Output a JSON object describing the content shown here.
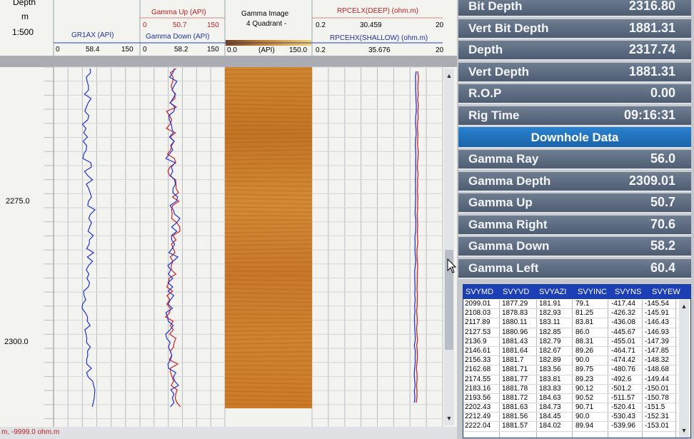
{
  "log_header": {
    "depth_label": "Depth",
    "depth_unit": "m",
    "scale": "1:500",
    "track1": {
      "name": "GR1AX (API)",
      "min": "0",
      "val": "58.4",
      "max": "150"
    },
    "track2": {
      "name1": "Gamma Up (API)",
      "min1": "0",
      "val1": "50.7",
      "max1": "150",
      "name2": "Gamma Down (API)",
      "min2": "0",
      "val2": "58.2",
      "max2": "150"
    },
    "track3": {
      "name": "Gamma Image",
      "sub": "4 Quadrant -",
      "min": "0.0",
      "unit": "(API)",
      "max": "150.0"
    },
    "track4": {
      "name1": "RPCELX(DEEP) (ohm.m)",
      "min1": "0.2",
      "val1": "30.459",
      "max1": "20",
      "name2": "RPCEHX(SHALLOW) (ohm.m)",
      "min2": "0.2",
      "val2": "35.676",
      "max2": "20"
    }
  },
  "depth_marks": [
    "2275.0",
    "2300.0"
  ],
  "status_text": "m, -9999.0 ohm.m",
  "colors": {
    "gr": "#2233cc",
    "gamma_up": "#cc2222",
    "gamma_down": "#2233cc",
    "deep": "#cc2222",
    "shallow": "#2233cc",
    "image": "#c87a22",
    "section": "#1f6fbd"
  },
  "realtime": [
    {
      "label": "Bit Depth",
      "value": "2316.80"
    },
    {
      "label": "Vert Bit Depth",
      "value": "1881.31"
    },
    {
      "label": "Depth",
      "value": "2317.74"
    },
    {
      "label": "Vert Depth",
      "value": "1881.31"
    },
    {
      "label": "R.O.P",
      "value": "0.00"
    },
    {
      "label": "Rig Time",
      "value": "09:16:31"
    }
  ],
  "downhole_title": "Downhole Data",
  "downhole": [
    {
      "label": "Gamma Ray",
      "value": "56.0"
    },
    {
      "label": "Gamma Depth",
      "value": "2309.01"
    },
    {
      "label": "Gamma Up",
      "value": "50.7"
    },
    {
      "label": "Gamma Right",
      "value": "70.6"
    },
    {
      "label": "Gamma Down",
      "value": "58.2"
    },
    {
      "label": "Gamma Left",
      "value": "60.4"
    }
  ],
  "survey": {
    "columns": [
      "SVYMD",
      "SVYVD",
      "SVYAZI",
      "SVYINC",
      "SVYNS",
      "SVYEW"
    ],
    "rows": [
      [
        "2099.01",
        "1877.29",
        "181.91",
        "79.1",
        "-417.44",
        "-145.54"
      ],
      [
        "2108.03",
        "1878.83",
        "182.93",
        "81.25",
        "-426.32",
        "-145.91"
      ],
      [
        "2117.89",
        "1880.11",
        "183.11",
        "83.81",
        "-436.08",
        "-146.43"
      ],
      [
        "2127.53",
        "1880.96",
        "182.85",
        "86.0",
        "-445.67",
        "-146.93"
      ],
      [
        "2136.9",
        "1881.43",
        "182.79",
        "88.31",
        "-455.01",
        "-147.39"
      ],
      [
        "2146.61",
        "1881.64",
        "182.67",
        "89.26",
        "-464.71",
        "-147.85"
      ],
      [
        "2156.33",
        "1881.7",
        "182.89",
        "90.0",
        "-474.42",
        "-148.32"
      ],
      [
        "2162.68",
        "1881.71",
        "183.56",
        "89.75",
        "-480.76",
        "-148.68"
      ],
      [
        "2174.55",
        "1881.77",
        "183.81",
        "89.23",
        "-492.6",
        "-149.44"
      ],
      [
        "2183.16",
        "1881.78",
        "183.83",
        "90.12",
        "-501.2",
        "-150.01"
      ],
      [
        "2193.56",
        "1881.72",
        "184.63",
        "90.52",
        "-511.57",
        "-150.78"
      ],
      [
        "2202.43",
        "1881.63",
        "184.73",
        "90.71",
        "-520.41",
        "-151.5"
      ],
      [
        "2212.49",
        "1881.56",
        "184.45",
        "90.0",
        "-530.43",
        "-152.31"
      ],
      [
        "2222.04",
        "1881.57",
        "184.02",
        "89.94",
        "-539.96",
        "-153.01"
      ]
    ]
  }
}
